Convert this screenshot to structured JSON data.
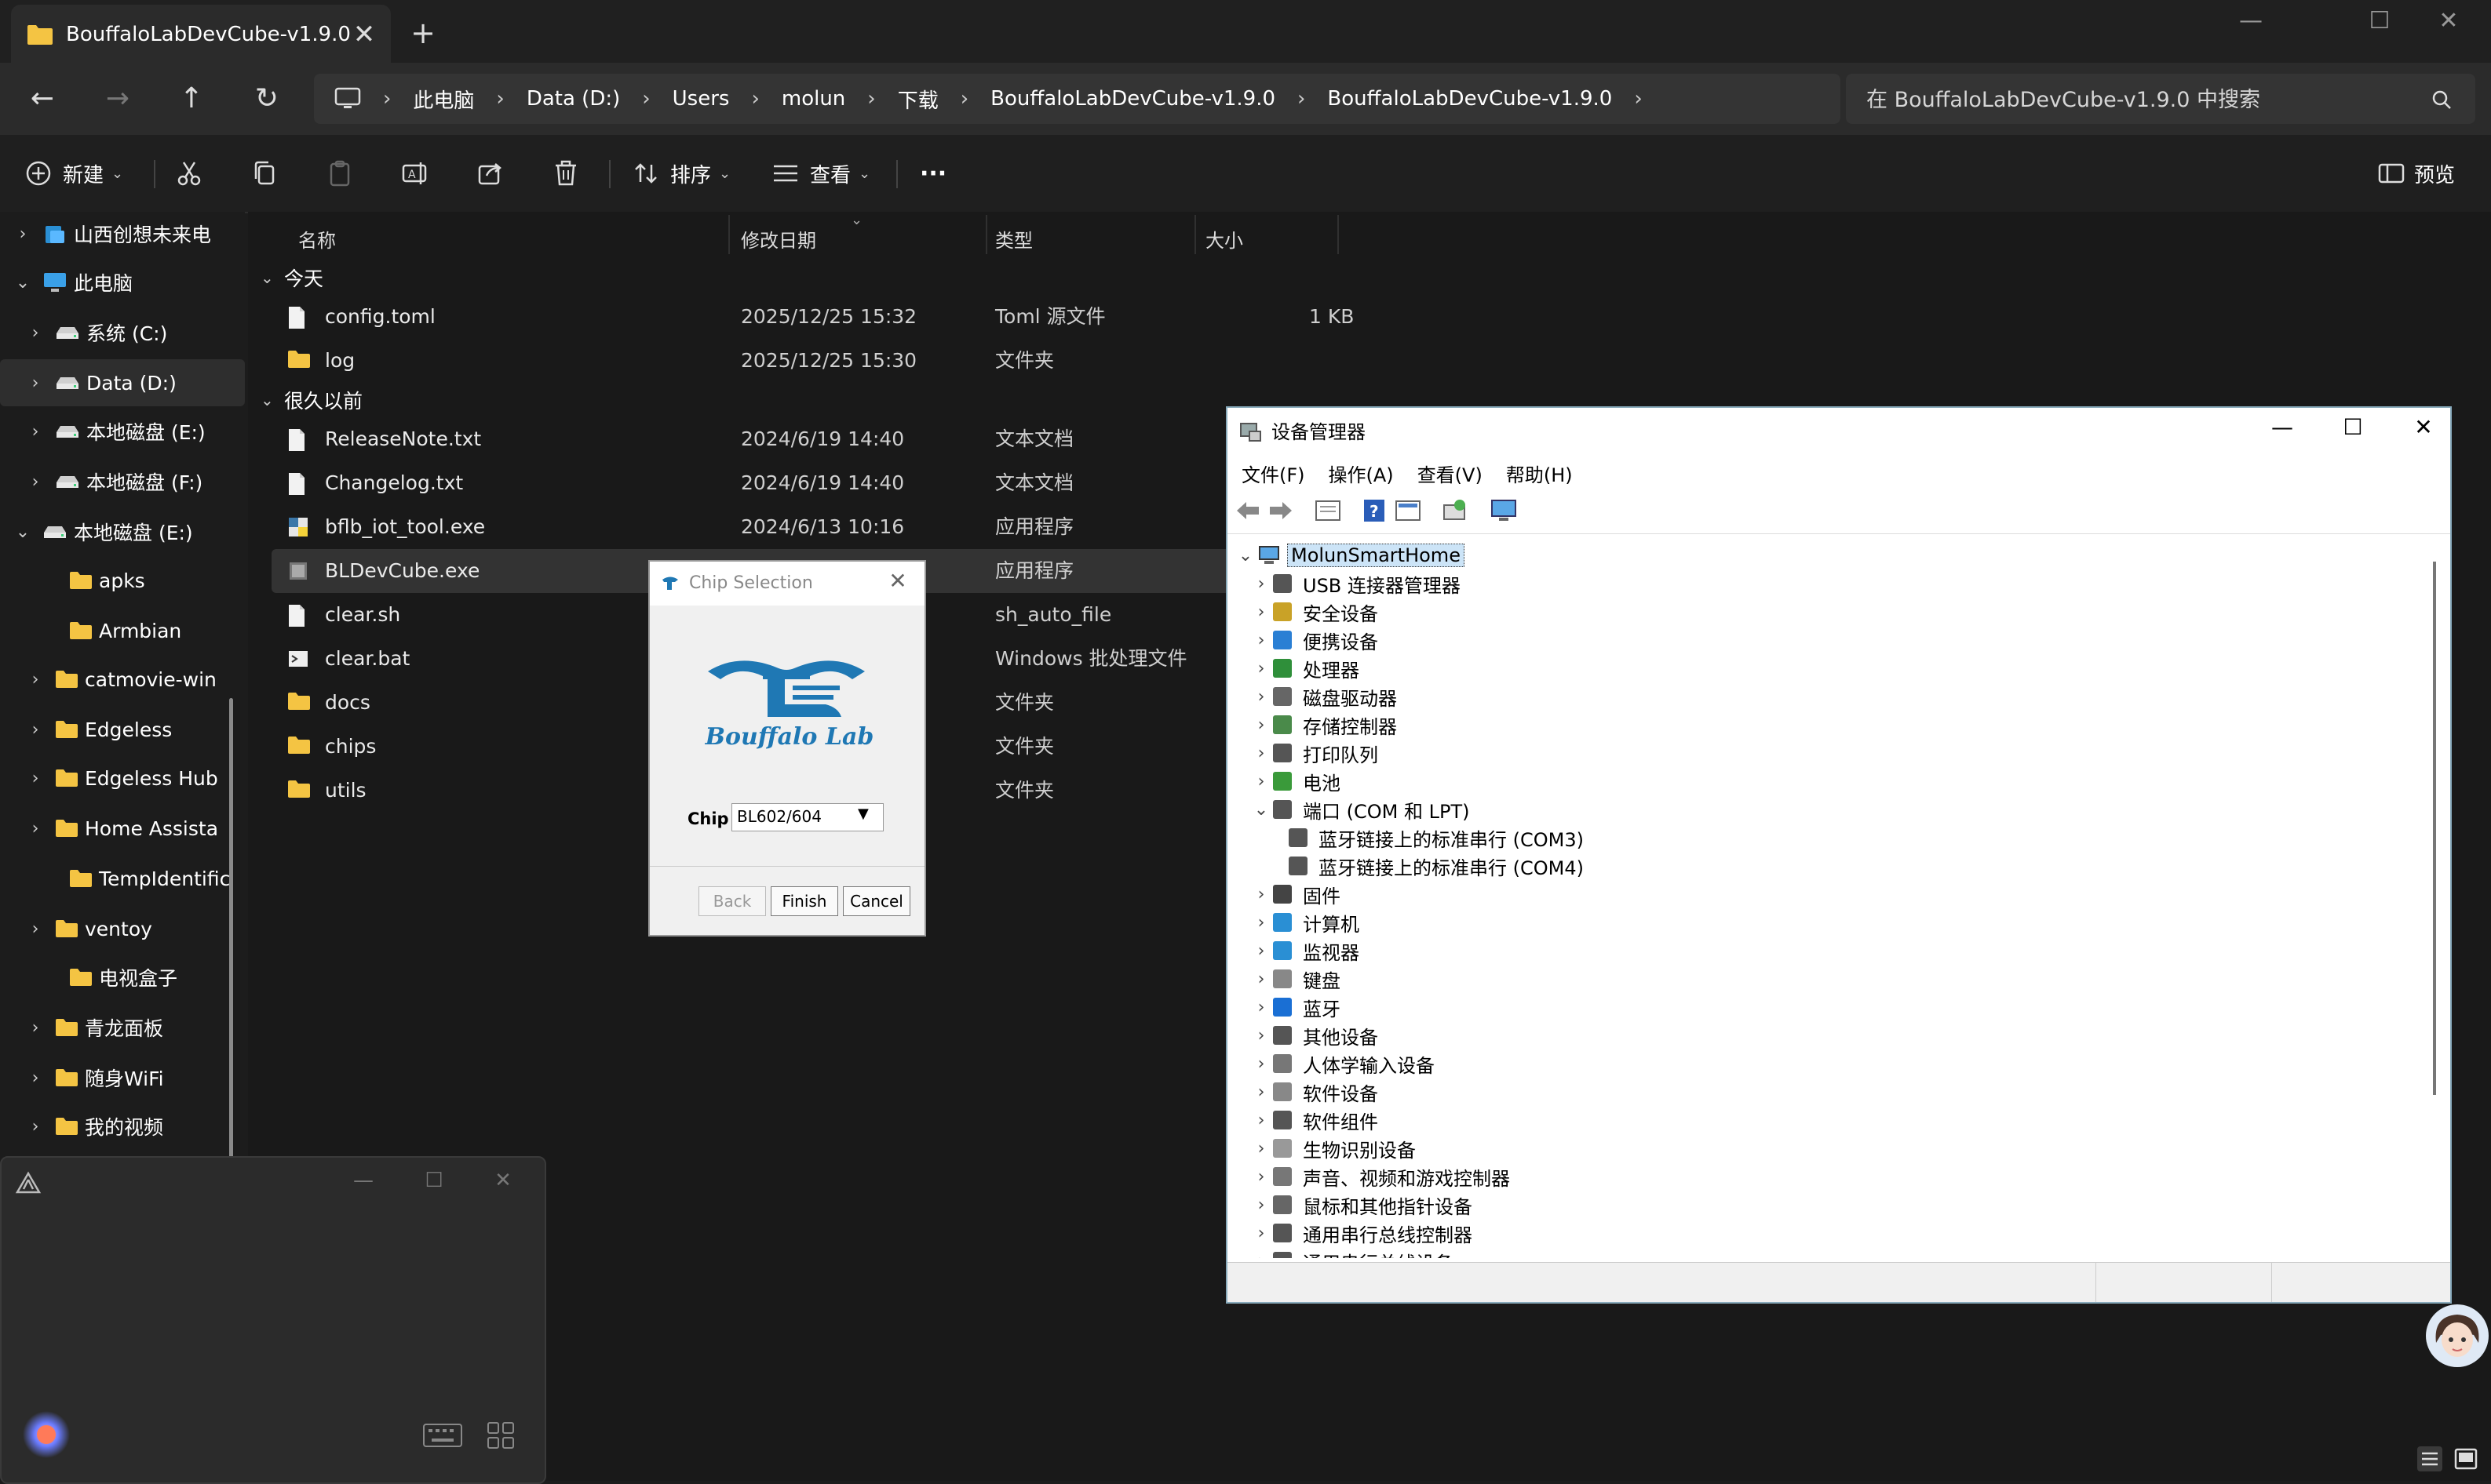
{
  "tab": {
    "title": "BouffaloLabDevCube-v1.9.0",
    "close": "✕",
    "new": "+"
  },
  "window_controls": {
    "minimize": "—",
    "maximize": "☐",
    "close": "✕"
  },
  "nav_buttons": {
    "back": "←",
    "forward": "→",
    "up": "↑",
    "refresh": "↻"
  },
  "address": {
    "separator": "›",
    "crumbs": [
      "此电脑",
      "Data (D:)",
      "Users",
      "molun",
      "下载",
      "BouffaloLabDevCube-v1.9.0",
      "BouffaloLabDevCube-v1.9.0"
    ]
  },
  "search": {
    "placeholder": "在 BouffaloLabDevCube-v1.9.0 中搜索"
  },
  "toolbar": {
    "new": "新建",
    "sort": "排序",
    "view": "查看",
    "more": "···",
    "preview": "预览"
  },
  "nav_items": [
    {
      "label": "山西创想未来电",
      "chev": "›",
      "icon": "cloud-icon"
    },
    {
      "label": "此电脑",
      "chev": "⌄",
      "icon": "computer-icon"
    },
    {
      "label": "系统 (C:)",
      "chev": "›",
      "icon": "drive-icon"
    },
    {
      "label": "Data (D:)",
      "chev": "›",
      "icon": "drive-icon"
    },
    {
      "label": "本地磁盘 (E:)",
      "chev": "›",
      "icon": "drive-icon"
    },
    {
      "label": "本地磁盘 (F:)",
      "chev": "›",
      "icon": "drive-icon"
    },
    {
      "label": "本地磁盘 (E:)",
      "chev": "⌄",
      "icon": "drive-icon"
    },
    {
      "label": "apks",
      "chev": "",
      "icon": "folder-icon"
    },
    {
      "label": "Armbian",
      "chev": "",
      "icon": "folder-icon"
    },
    {
      "label": "catmovie-win",
      "chev": "›",
      "icon": "folder-icon"
    },
    {
      "label": "Edgeless",
      "chev": "›",
      "icon": "folder-icon"
    },
    {
      "label": "Edgeless Hub",
      "chev": "›",
      "icon": "folder-icon"
    },
    {
      "label": "Home Assista",
      "chev": "›",
      "icon": "folder-icon"
    },
    {
      "label": "TempIdentific",
      "chev": "",
      "icon": "folder-icon"
    },
    {
      "label": "ventoy",
      "chev": "›",
      "icon": "folder-icon"
    },
    {
      "label": "电视盒子",
      "chev": "",
      "icon": "folder-icon"
    },
    {
      "label": "青龙面板",
      "chev": "›",
      "icon": "folder-icon"
    },
    {
      "label": "随身WiFi",
      "chev": "›",
      "icon": "folder-icon"
    },
    {
      "label": "我的视频",
      "chev": "›",
      "icon": "folder-icon"
    }
  ],
  "columns": {
    "name": "名称",
    "date": "修改日期",
    "type": "类型",
    "size": "大小"
  },
  "groups": {
    "today": "今天",
    "long_ago": "很久以前",
    "chev": "⌄"
  },
  "files_today": [
    {
      "name": "config.toml",
      "date": "2025/12/25 15:32",
      "type": "Toml 源文件",
      "size": "1 KB",
      "icon": "file-icon"
    },
    {
      "name": "log",
      "date": "2025/12/25 15:30",
      "type": "文件夹",
      "size": "",
      "icon": "folder-icon"
    }
  ],
  "files_old": [
    {
      "name": "ReleaseNote.txt",
      "date": "2024/6/19 14:40",
      "type": "文本文档",
      "size": "",
      "icon": "file-icon"
    },
    {
      "name": "Changelog.txt",
      "date": "2024/6/19 14:40",
      "type": "文本文档",
      "size": "",
      "icon": "file-icon"
    },
    {
      "name": "bflb_iot_tool.exe",
      "date": "2024/6/13 10:16",
      "type": "应用程序",
      "size": "",
      "icon": "python-exe-icon"
    },
    {
      "name": "BLDevCube.exe",
      "date": "",
      "type": "应用程序",
      "size": "",
      "icon": "exe-icon"
    },
    {
      "name": "clear.sh",
      "date": "",
      "type": "sh_auto_file",
      "size": "",
      "icon": "file-icon"
    },
    {
      "name": "clear.bat",
      "date": "",
      "type": "Windows 批处理文件",
      "size": "",
      "icon": "bat-icon"
    },
    {
      "name": "docs",
      "date": "",
      "type": "文件夹",
      "size": "",
      "icon": "folder-icon"
    },
    {
      "name": "chips",
      "date": "",
      "type": "文件夹",
      "size": "",
      "icon": "folder-icon"
    },
    {
      "name": "utils",
      "date": "",
      "type": "文件夹",
      "size": "",
      "icon": "folder-icon"
    }
  ],
  "device_manager": {
    "title": "设备管理器",
    "menu": [
      "文件(F)",
      "操作(A)",
      "查看(V)",
      "帮助(H)"
    ],
    "root": "MolunSmartHome",
    "nodes": [
      {
        "label": "USB 连接器管理器",
        "chev": "›",
        "color": "#555555",
        "level": 1
      },
      {
        "label": "安全设备",
        "chev": "›",
        "color": "#c9a227",
        "level": 1
      },
      {
        "label": "便携设备",
        "chev": "›",
        "color": "#2a7fd4",
        "level": 1
      },
      {
        "label": "处理器",
        "chev": "›",
        "color": "#2f8f3a",
        "level": 1
      },
      {
        "label": "磁盘驱动器",
        "chev": "›",
        "color": "#666666",
        "level": 1
      },
      {
        "label": "存储控制器",
        "chev": "›",
        "color": "#4a8a4a",
        "level": 1
      },
      {
        "label": "打印队列",
        "chev": "›",
        "color": "#555555",
        "level": 1
      },
      {
        "label": "电池",
        "chev": "›",
        "color": "#3a9a3a",
        "level": 1
      },
      {
        "label": "端口 (COM 和 LPT)",
        "chev": "⌄",
        "color": "#555555",
        "level": 1
      },
      {
        "label": "蓝牙链接上的标准串行 (COM3)",
        "chev": "",
        "color": "#555555",
        "level": 2
      },
      {
        "label": "蓝牙链接上的标准串行 (COM4)",
        "chev": "",
        "color": "#555555",
        "level": 2
      },
      {
        "label": "固件",
        "chev": "›",
        "color": "#444444",
        "level": 1
      },
      {
        "label": "计算机",
        "chev": "›",
        "color": "#2a8fd4",
        "level": 1
      },
      {
        "label": "监视器",
        "chev": "›",
        "color": "#2a8fd4",
        "level": 1
      },
      {
        "label": "键盘",
        "chev": "›",
        "color": "#888888",
        "level": 1
      },
      {
        "label": "蓝牙",
        "chev": "›",
        "color": "#1a6fd4",
        "level": 1
      },
      {
        "label": "其他设备",
        "chev": "›",
        "color": "#555555",
        "level": 1
      },
      {
        "label": "人体学输入设备",
        "chev": "›",
        "color": "#777777",
        "level": 1
      },
      {
        "label": "软件设备",
        "chev": "›",
        "color": "#888888",
        "level": 1
      },
      {
        "label": "软件组件",
        "chev": "›",
        "color": "#555555",
        "level": 1
      },
      {
        "label": "生物识别设备",
        "chev": "›",
        "color": "#999999",
        "level": 1
      },
      {
        "label": "声音、视频和游戏控制器",
        "chev": "›",
        "color": "#777777",
        "level": 1
      },
      {
        "label": "鼠标和其他指针设备",
        "chev": "›",
        "color": "#666666",
        "level": 1
      },
      {
        "label": "通用串行总线控制器",
        "chev": "›",
        "color": "#555555",
        "level": 1
      },
      {
        "label": "通用串行总线设备",
        "chev": "›",
        "color": "#555555",
        "level": 1
      }
    ]
  },
  "chip_dialog": {
    "title": "Chip Selection",
    "logo_text": "Bouffalo Lab",
    "chip_label": "Chip",
    "chip_value": "BL602/604",
    "back": "Back",
    "finish": "Finish",
    "cancel": "Cancel"
  },
  "colors": {
    "accent": "#2a7fd4",
    "folder": "#f4c443",
    "logo_blue": "#1f78b4"
  }
}
